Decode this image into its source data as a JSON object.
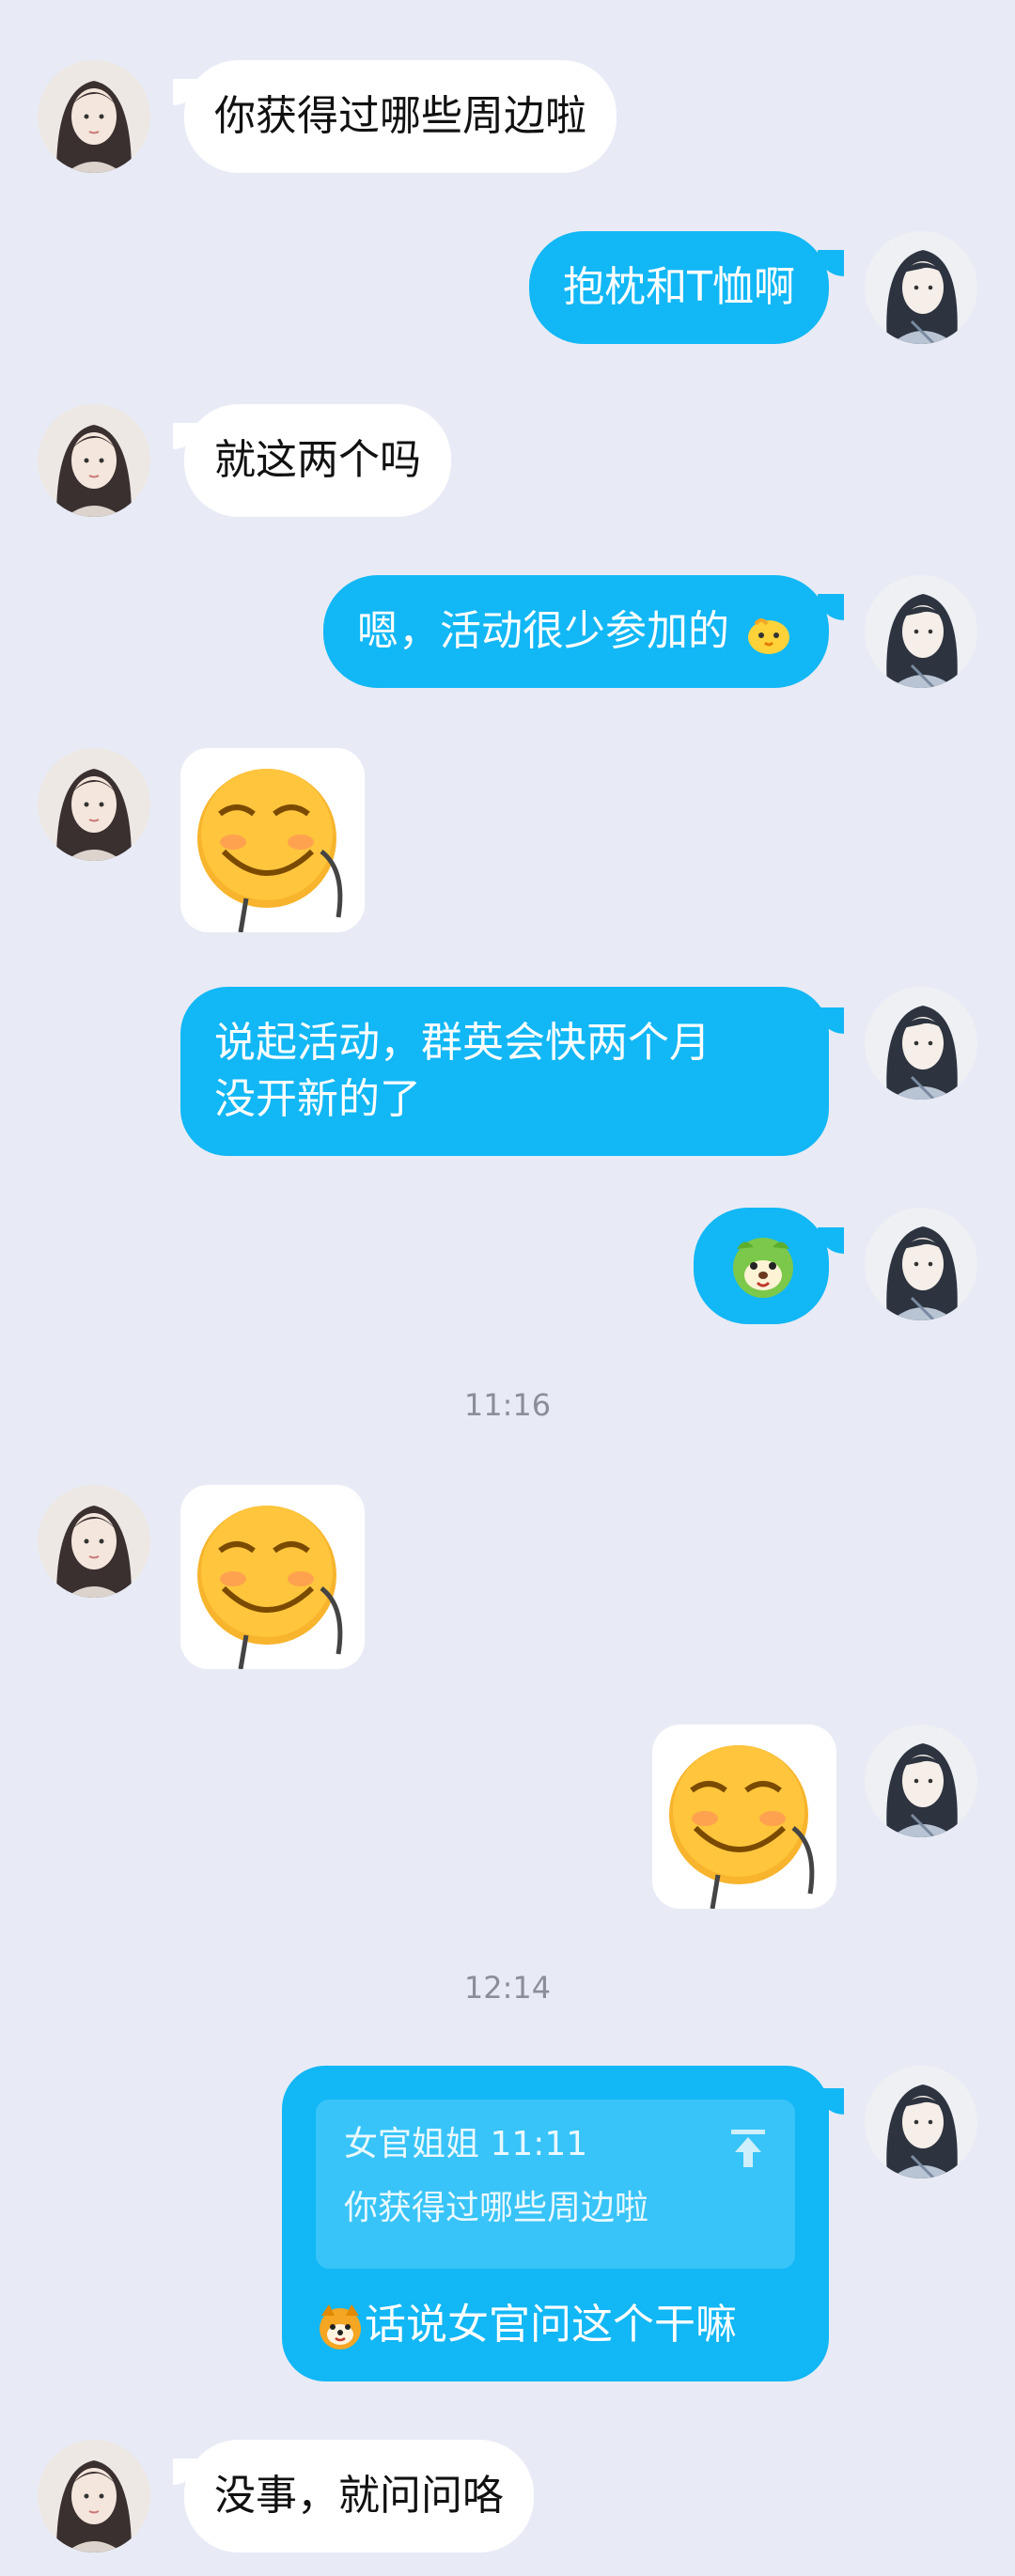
{
  "conversation": {
    "messages": [
      {
        "side": "left",
        "text": "你获得过哪些周边啦"
      },
      {
        "side": "right",
        "text": "抱枕和T恤啊"
      },
      {
        "side": "left",
        "text": "就这两个吗"
      },
      {
        "side": "right",
        "text": "嗯，活动很少参加的"
      },
      {
        "side": "left",
        "sticker": "smiling-face-sticker"
      },
      {
        "side": "right",
        "line1": "说起活动，群英会快两个月",
        "line2": "没开新的了"
      },
      {
        "side": "right",
        "emoji": "green-puppy-emoji"
      },
      {
        "side": "left",
        "sticker": "smiling-face-sticker"
      },
      {
        "side": "right",
        "sticker": "smiling-face-sticker"
      },
      {
        "side": "right",
        "quote_author": "女官姐姐 11:11",
        "quote_text": "你获得过哪些周边啦",
        "text": "话说女官问这个干嘛"
      },
      {
        "side": "left",
        "text": "没事，就问问咯"
      }
    ],
    "timestamps": [
      "11:16",
      "12:14"
    ]
  },
  "colors": {
    "background": "#E8EBF5",
    "bubble_self": "#12B7F5",
    "bubble_other": "#FFFFFF",
    "quote_box": "#38C4F8"
  }
}
